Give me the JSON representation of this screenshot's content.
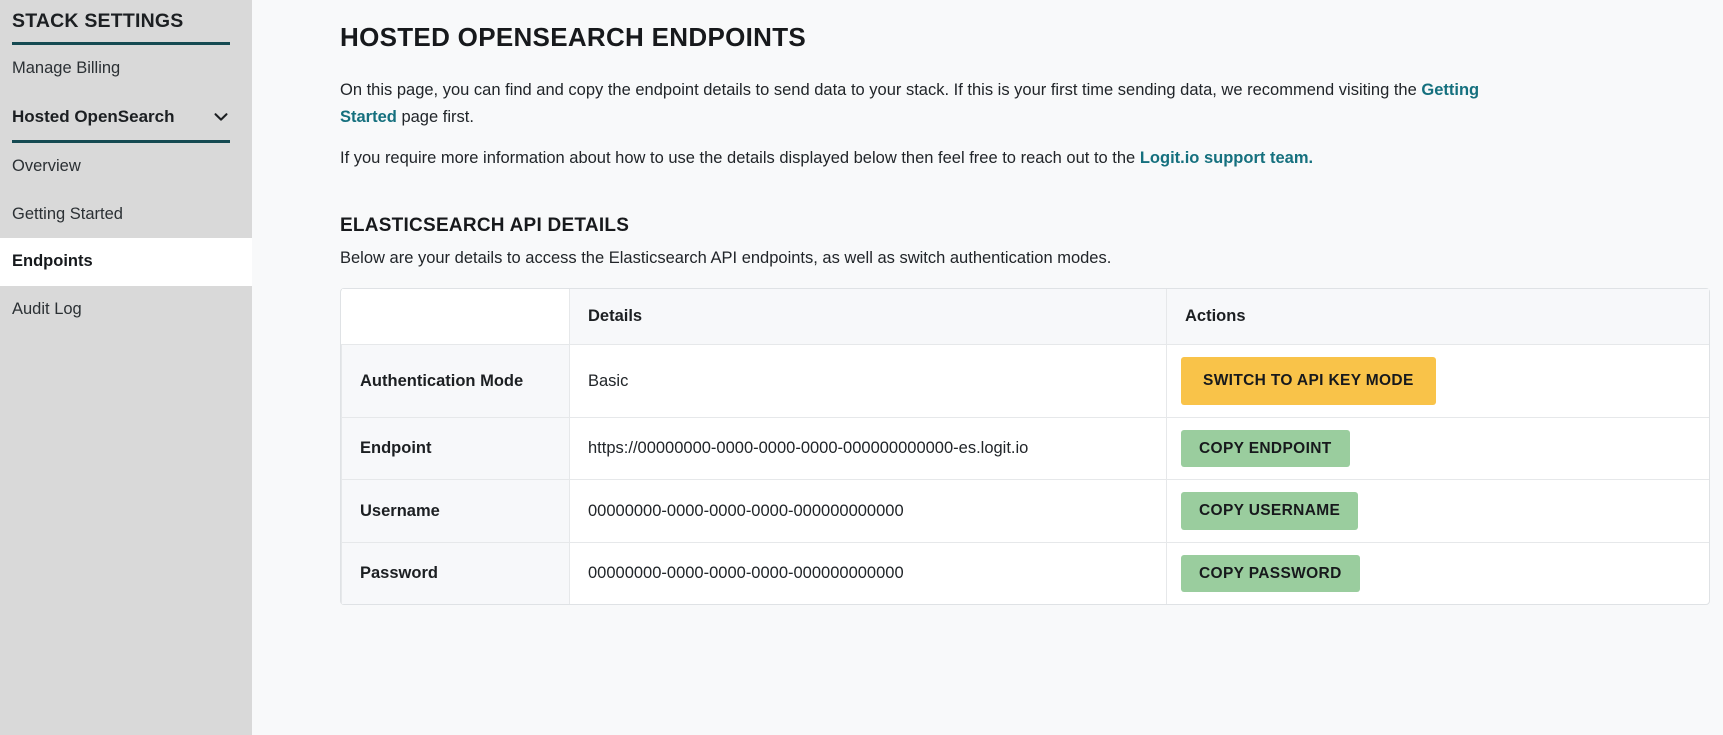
{
  "sidebar": {
    "section_title": "STACK SETTINGS",
    "items": [
      {
        "label": "Manage Billing"
      }
    ],
    "group": {
      "label": "Hosted OpenSearch",
      "chevron_icon": "chevron-down-icon"
    },
    "sub_items": [
      {
        "label": "Overview",
        "active": false
      },
      {
        "label": "Getting Started",
        "active": false
      },
      {
        "label": "Endpoints",
        "active": true
      },
      {
        "label": "Audit Log",
        "active": false
      }
    ]
  },
  "main": {
    "page_title": "HOSTED OPENSEARCH ENDPOINTS",
    "intro": {
      "p1_before_link": "On this page, you can find and copy the endpoint details to send data to your stack. If this is your first time sending data, we recommend visiting the ",
      "p1_link": "Getting Started",
      "p1_after_link": " page first.",
      "p2_before_link": "If you require more information about how to use the details displayed below then feel free to reach out to the ",
      "p2_link": "Logit.io support team.",
      "p2_after_link": ""
    },
    "section": {
      "title": "ELASTICSEARCH API DETAILS",
      "subtitle": "Below are your details to access the Elasticsearch API endpoints, as well as switch authentication modes."
    },
    "table": {
      "headers": {
        "blank": "",
        "details": "Details",
        "actions": "Actions"
      },
      "rows": [
        {
          "label": "Authentication Mode",
          "value": "Basic",
          "action_label": "SWITCH TO API KEY MODE",
          "action_style": "warning"
        },
        {
          "label": "Endpoint",
          "value": "https://00000000-0000-0000-0000-000000000000-es.logit.io",
          "action_label": "COPY ENDPOINT",
          "action_style": "copy"
        },
        {
          "label": "Username",
          "value": "00000000-0000-0000-0000-000000000000",
          "action_label": "COPY USERNAME",
          "action_style": "copy"
        },
        {
          "label": "Password",
          "value": "00000000-0000-0000-0000-000000000000",
          "action_label": "COPY PASSWORD",
          "action_style": "copy"
        }
      ]
    }
  },
  "colors": {
    "sidebar_bg": "#d9d9d9",
    "sidebar_rule": "#154a52",
    "link": "#15707e",
    "warning_button": "#f9c349",
    "copy_button": "#9acd9e",
    "page_bg": "#f8f9fa",
    "card_bg": "#ffffff",
    "table_header_bg": "#f7f8fa",
    "border": "#e6e8ea"
  }
}
